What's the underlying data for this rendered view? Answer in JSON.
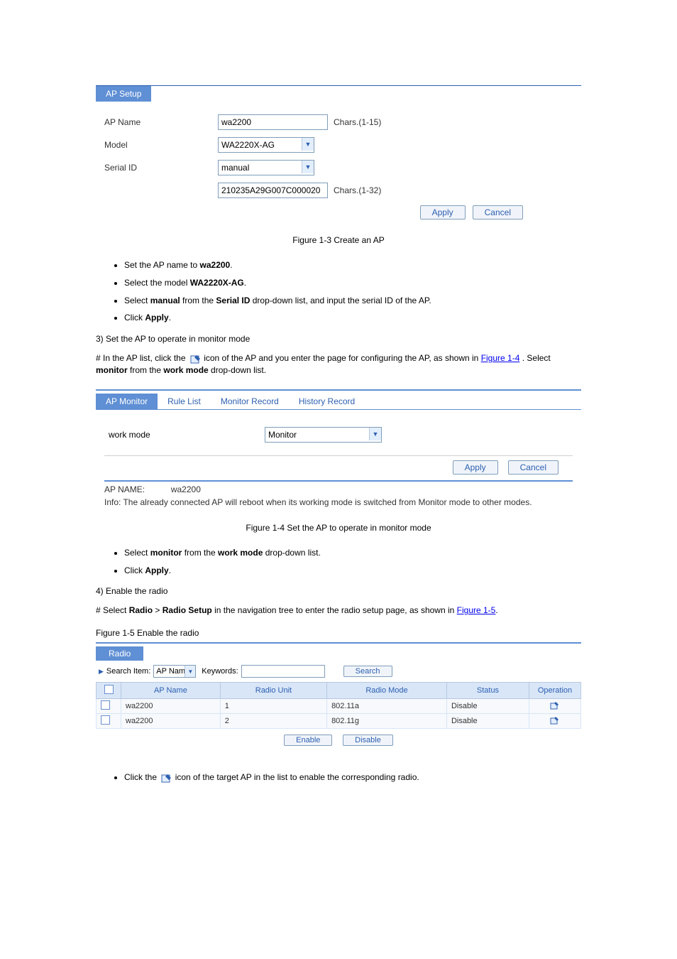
{
  "apSetup": {
    "tabLabel": "AP Setup",
    "rows": {
      "apNameLabel": "AP Name",
      "apNameValue": "wa2200",
      "apNameHint": "Chars.(1-15)",
      "modelLabel": "Model",
      "modelValue": "WA2220X-AG",
      "serialLabel": "Serial ID",
      "serialMode": "manual",
      "serialValue": "210235A29G007C000020",
      "serialHint": "Chars.(1-32)"
    },
    "applyBtn": "Apply",
    "cancelBtn": "Cancel"
  },
  "fig1Caption": "Figure 1-3 Create an AP",
  "bullets1": {
    "b1a": "Set the AP name to ",
    "b1b": "wa2200",
    "b1c": ".",
    "b2a": "Select the model ",
    "b2b": "WA2220X-AG",
    "b2c": ".",
    "b3a": "Select ",
    "b3b": "manual",
    "b3c": " from the ",
    "b3d": "Serial ID",
    "b3e": " drop-down list, and input the serial ID of the AP.",
    "b4a": "Click ",
    "b4b": "Apply",
    "b4c": "."
  },
  "step3": "3) Set the AP to operate in monitor mode",
  "step3para_a": "# In the AP list, click the ",
  "step3para_b": " icon of the AP and you enter the page for configuring the AP, as shown in ",
  "step3para_c": "Figure 1-4",
  "step3para_d": ". Select ",
  "step3para_e": "monitor",
  "step3para_f": " from the ",
  "step3para_g": "work mode",
  "step3para_h": " drop-down list.",
  "apMonitor": {
    "tab1": "AP Monitor",
    "tab2": "Rule List",
    "tab3": "Monitor Record",
    "tab4": "History Record",
    "workModeLabel": "work mode",
    "workModeValue": "Monitor",
    "applyBtn": "Apply",
    "cancelBtn": "Cancel",
    "apNameLabel": "AP NAME:",
    "apNameValue": "wa2200",
    "infoText": "Info: The already connected AP will reboot when its working mode is switched from Monitor mode to other modes."
  },
  "fig2Caption": "Figure 1-4 Set the AP to operate in monitor mode",
  "bullets2": {
    "b1a": "Select ",
    "b1b": "monitor",
    "b1c": " from the ",
    "b1d": "work mode",
    "b1e": " drop-down list.",
    "b2a": "Click ",
    "b2b": "Apply",
    "b2c": "."
  },
  "step4": "4) Enable the radio",
  "step4para_a": "# Select ",
  "step4para_b": "Radio",
  "step4para_c": " > ",
  "step4para_d": "Radio Setup",
  "step4para_e": " in the navigation tree to enter the radio setup page, as shown in ",
  "step4para_f": "Figure 1-5",
  "step4para_g": ".",
  "fig3Caption": "Figure 1-5 Enable the radio",
  "radio": {
    "tabLabel": "Radio",
    "searchItemLabel": "Search Item:",
    "searchItemValue": "AP Name",
    "keywordsLabel": "Keywords:",
    "keywordsValue": "",
    "searchBtn": "Search",
    "headers": {
      "apName": "AP Name",
      "radioUnit": "Radio Unit",
      "radioMode": "Radio Mode",
      "status": "Status",
      "operation": "Operation"
    },
    "rows": [
      {
        "apName": "wa2200",
        "radioUnit": "1",
        "radioMode": "802.11a",
        "status": "Disable"
      },
      {
        "apName": "wa2200",
        "radioUnit": "2",
        "radioMode": "802.11g",
        "status": "Disable"
      }
    ],
    "enableBtn": "Enable",
    "disableBtn": "Disable"
  },
  "lastBullet_a": "Click the ",
  "lastBullet_b": " icon of the target AP in the list to enable the corresponding radio."
}
